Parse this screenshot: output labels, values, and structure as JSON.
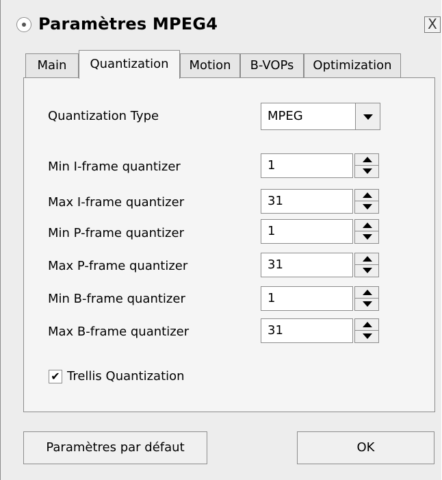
{
  "window": {
    "title": "Paramètres MPEG4",
    "close_glyph": "X"
  },
  "tabs": [
    {
      "label": "Main",
      "active": false
    },
    {
      "label": "Quantization",
      "active": true
    },
    {
      "label": "Motion",
      "active": false
    },
    {
      "label": "B-VOPs",
      "active": false
    },
    {
      "label": "Optimization",
      "active": false
    }
  ],
  "quantization": {
    "type_label": "Quantization Type",
    "type_value": "MPEG",
    "fields": [
      {
        "label": "Min I-frame quantizer",
        "value": "1"
      },
      {
        "label": "Max I-frame quantizer",
        "value": "31"
      },
      {
        "label": "Min P-frame quantizer",
        "value": "1"
      },
      {
        "label": "Max P-frame quantizer",
        "value": "31"
      },
      {
        "label": "Min B-frame quantizer",
        "value": "1"
      },
      {
        "label": "Max B-frame quantizer",
        "value": "31"
      }
    ],
    "trellis": {
      "label": "Trellis Quantization",
      "checked": true,
      "check_glyph": "✔"
    }
  },
  "buttons": {
    "defaults_label": "Paramètres par défaut",
    "ok_label": "OK"
  }
}
